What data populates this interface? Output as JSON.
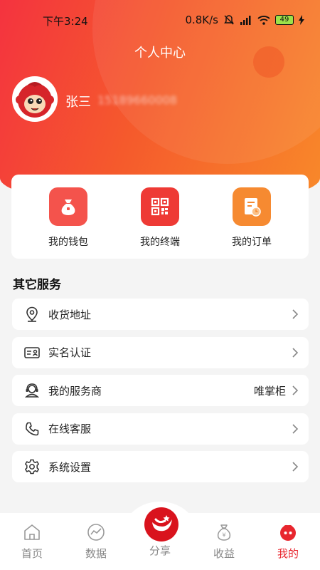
{
  "status_bar": {
    "time": "下午3:24",
    "network_speed": "0.8K/s",
    "battery": "49"
  },
  "header": {
    "title": "个人中心"
  },
  "user": {
    "name": "张三",
    "phone": "15189660008"
  },
  "quick_actions": [
    {
      "label": "我的钱包",
      "icon": "wallet-bag-icon"
    },
    {
      "label": "我的终端",
      "icon": "qr-code-icon"
    },
    {
      "label": "我的订单",
      "icon": "order-doc-icon"
    }
  ],
  "services": {
    "title": "其它服务",
    "items": [
      {
        "label": "收货地址",
        "value": "",
        "icon": "location-pin-icon"
      },
      {
        "label": "实名认证",
        "value": "",
        "icon": "id-card-icon"
      },
      {
        "label": "我的服务商",
        "value": "唯掌柜",
        "icon": "service-agent-icon"
      },
      {
        "label": "在线客服",
        "value": "",
        "icon": "phone-icon"
      },
      {
        "label": "系统设置",
        "value": "",
        "icon": "gear-icon"
      }
    ]
  },
  "tabbar": {
    "items": [
      {
        "label": "首页",
        "icon": "home-icon"
      },
      {
        "label": "数据",
        "icon": "chart-icon"
      },
      {
        "label": "分享",
        "icon": "share-logo-icon"
      },
      {
        "label": "收益",
        "icon": "money-bag-icon"
      },
      {
        "label": "我的",
        "icon": "profile-icon"
      }
    ],
    "active": "我的"
  },
  "colors": {
    "accent": "#e8262e",
    "header_start": "#f4333f",
    "header_end": "#f8892a",
    "wallet": "#f4534c",
    "terminal": "#ee3a35",
    "order": "#f68a31"
  }
}
